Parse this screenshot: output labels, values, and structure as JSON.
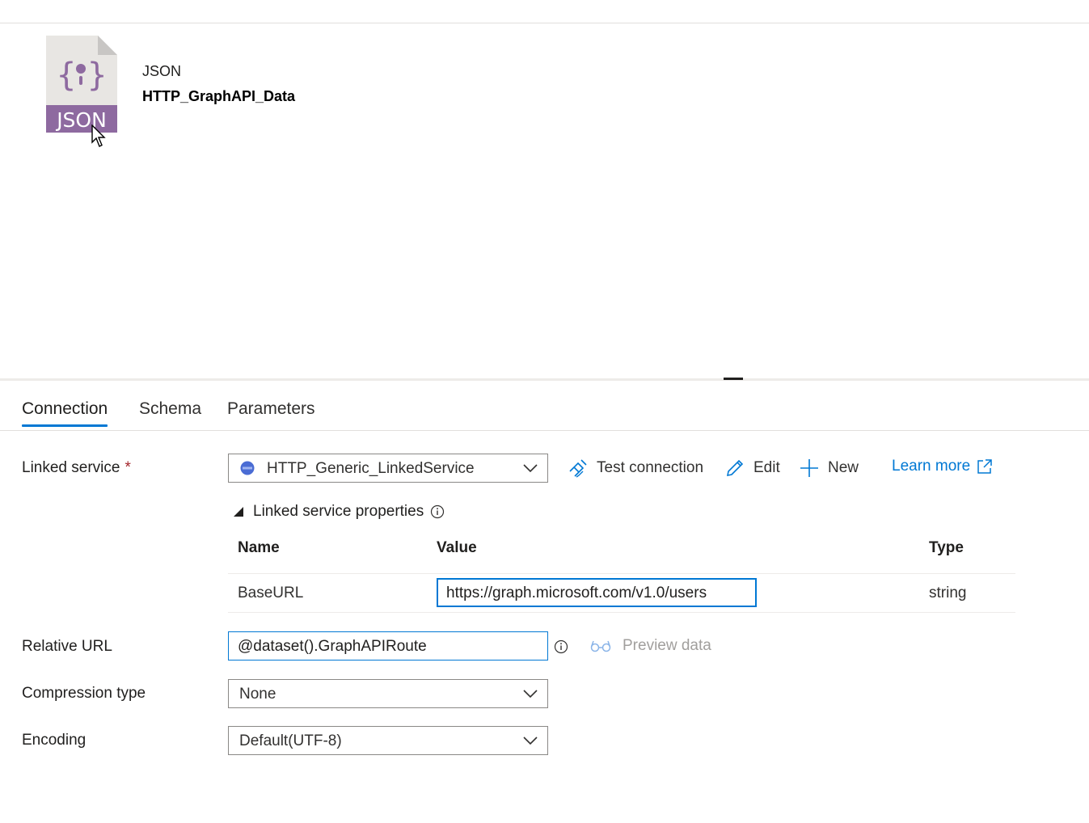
{
  "dataset": {
    "icon_label": "JSON",
    "type": "JSON",
    "name": "HTTP_GraphAPI_Data"
  },
  "tabs": [
    {
      "label": "Connection",
      "active": true
    },
    {
      "label": "Schema",
      "active": false
    },
    {
      "label": "Parameters",
      "active": false
    }
  ],
  "linked_service": {
    "label": "Linked service",
    "required_mark": "*",
    "value": "HTTP_Generic_LinkedService",
    "service_icon": "http-globe-icon",
    "actions": {
      "test_connection": "Test connection",
      "edit": "Edit",
      "new": "New",
      "learn_more": "Learn more"
    }
  },
  "linked_service_properties": {
    "label": "Linked service properties",
    "columns": [
      "Name",
      "Value",
      "Type"
    ],
    "rows": [
      {
        "name": "BaseURL",
        "value": "https://graph.microsoft.com/v1.0/users",
        "type": "string"
      }
    ]
  },
  "relative_url": {
    "label": "Relative URL",
    "value": "@dataset().GraphAPIRoute",
    "preview_label": "Preview data"
  },
  "compression_type": {
    "label": "Compression type",
    "value": "None"
  },
  "encoding": {
    "label": "Encoding",
    "value": "Default(UTF-8)"
  },
  "colors": {
    "accent": "#0078d4",
    "json_icon": "#8e6aa0",
    "required": "#a4262c"
  }
}
